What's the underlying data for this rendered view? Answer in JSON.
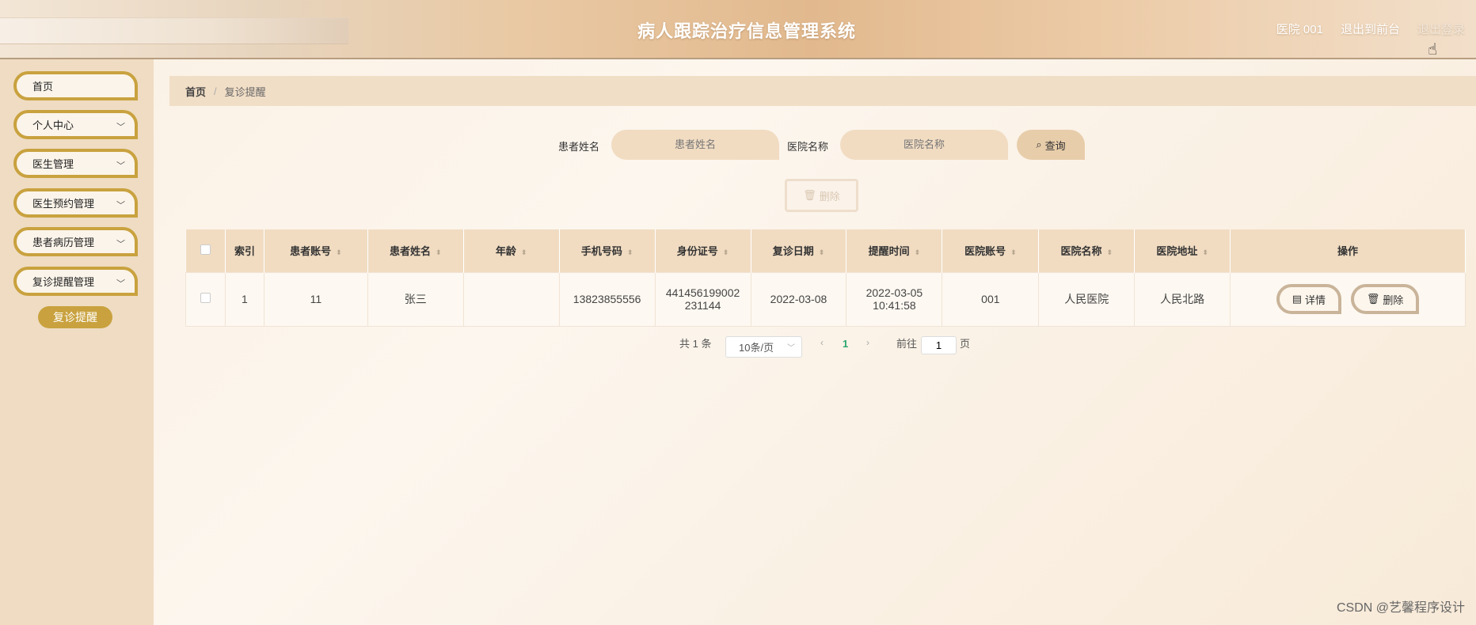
{
  "header": {
    "title": "病人跟踪治疗信息管理系统",
    "user": "医院 001",
    "front": "退出到前台",
    "logout": "退出登录"
  },
  "sidebar": {
    "items": [
      {
        "label": "首页",
        "has_chevron": false
      },
      {
        "label": "个人中心",
        "has_chevron": true
      },
      {
        "label": "医生管理",
        "has_chevron": true
      },
      {
        "label": "医生预约管理",
        "has_chevron": true
      },
      {
        "label": "患者病历管理",
        "has_chevron": true
      },
      {
        "label": "复诊提醒管理",
        "has_chevron": true
      }
    ],
    "active_sub": "复诊提醒"
  },
  "breadcrumb": {
    "home": "首页",
    "separator": "/",
    "current": "复诊提醒"
  },
  "search": {
    "name_label": "患者姓名",
    "name_placeholder": "患者姓名",
    "hospital_label": "医院名称",
    "hospital_placeholder": "医院名称",
    "query_label": "查询"
  },
  "toolbar": {
    "delete_label": "删除"
  },
  "table": {
    "columns": [
      "索引",
      "患者账号",
      "患者姓名",
      "年龄",
      "手机号码",
      "身份证号",
      "复诊日期",
      "提醒时间",
      "医院账号",
      "医院名称",
      "医院地址",
      "操作"
    ],
    "rows": [
      {
        "index": "1",
        "account": "11",
        "name": "张三",
        "age": "",
        "phone": "13823855556",
        "id_card": "441456199002231144",
        "revisit_date": "2022-03-08",
        "remind_time": "2022-03-05 10:41:58",
        "hospital_account": "001",
        "hospital_name": "人民医院",
        "hospital_address": "人民北路",
        "detail_label": "详情",
        "delete_label": "删除"
      }
    ]
  },
  "pagination": {
    "total": "共 1 条",
    "page_size": "10条/页",
    "current": "1",
    "goto_prefix": "前往",
    "goto_value": "1",
    "goto_suffix": "页"
  },
  "watermark": "CSDN @艺馨程序设计",
  "colors": {
    "accent": "#c9a23f",
    "header": "#e2b98e",
    "sidebar": "#efdcc3",
    "page_active": "#2aa56f"
  }
}
